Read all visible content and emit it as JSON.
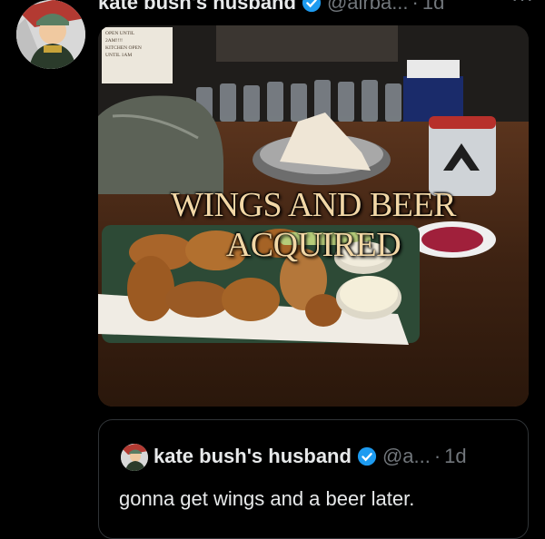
{
  "tweet": {
    "display_name": "kate bush's husband",
    "handle": "@airba...",
    "separator": "·",
    "time": "1d",
    "more": "···"
  },
  "media": {
    "caption": "WINGS AND BEER ACQUIRED",
    "sign_lines": [
      "OPEN UNTIL",
      "2AM!!!!",
      "KITCHEN OPEN",
      "UNTIL 1AM"
    ]
  },
  "quote": {
    "display_name": "kate bush's husband",
    "handle": "@a...",
    "separator": "·",
    "time": "1d",
    "text": "gonna get wings and a beer later."
  },
  "colors": {
    "verified": "#1d9bf0",
    "secondary_text": "#71767b",
    "border": "#2f3336"
  }
}
